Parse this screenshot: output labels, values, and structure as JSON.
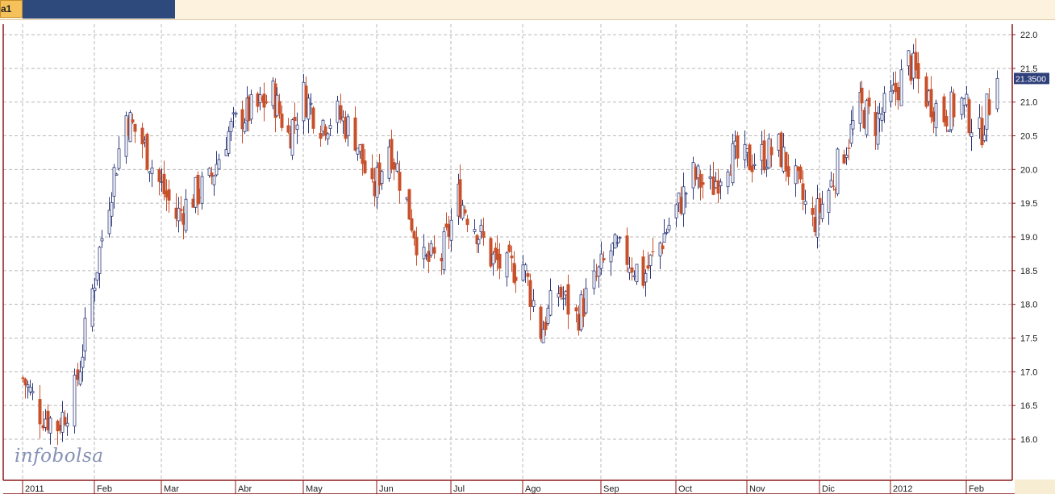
{
  "tab": {
    "label": "a1"
  },
  "watermark": {
    "text": "infobolsa"
  },
  "chart_data": {
    "type": "candlestick",
    "title": "",
    "xlabel": "",
    "ylabel": "",
    "ylim": [
      15.5,
      22.2
    ],
    "y_ticks": [
      "22.0",
      "21.5",
      "21.0",
      "20.5",
      "20.0",
      "19.5",
      "19.0",
      "18.5",
      "18.0",
      "17.5",
      "17.0",
      "16.5",
      "16.0"
    ],
    "x_ticks": [
      {
        "label": "2011",
        "date": "2011-01-03"
      },
      {
        "label": "Feb",
        "date": "2011-02-01"
      },
      {
        "label": "Mar",
        "date": "2011-03-01"
      },
      {
        "label": "Abr",
        "date": "2011-04-01"
      },
      {
        "label": "May",
        "date": "2011-05-02"
      },
      {
        "label": "Jun",
        "date": "2011-06-01"
      },
      {
        "label": "Jul",
        "date": "2011-07-01"
      },
      {
        "label": "Ago",
        "date": "2011-08-01"
      },
      {
        "label": "Sep",
        "date": "2011-09-01"
      },
      {
        "label": "Oct",
        "date": "2011-10-03"
      },
      {
        "label": "Nov",
        "date": "2011-11-01"
      },
      {
        "label": "Dic",
        "date": "2011-12-01"
      },
      {
        "label": "2012",
        "date": "2012-01-02"
      },
      {
        "label": "Feb",
        "date": "2012-02-01"
      }
    ],
    "last_price": "21.3500",
    "grid": true,
    "colors": {
      "up": "#2e3a7a",
      "down": "#c8502a",
      "grid": "#b8b8b8",
      "axis": "#8b1a1a",
      "tag": "#2e3f7a"
    },
    "closes": [
      {
        "date": "2011-01-03",
        "close": 16.9
      },
      {
        "date": "2011-01-10",
        "close": 16.4
      },
      {
        "date": "2011-01-17",
        "close": 16.2
      },
      {
        "date": "2011-01-24",
        "close": 16.7
      },
      {
        "date": "2011-01-31",
        "close": 18.2
      },
      {
        "date": "2011-02-07",
        "close": 19.6
      },
      {
        "date": "2011-02-14",
        "close": 20.8
      },
      {
        "date": "2011-02-21",
        "close": 20.4
      },
      {
        "date": "2011-02-28",
        "close": 19.8
      },
      {
        "date": "2011-03-07",
        "close": 19.3
      },
      {
        "date": "2011-03-14",
        "close": 19.6
      },
      {
        "date": "2011-03-21",
        "close": 19.8
      },
      {
        "date": "2011-03-28",
        "close": 20.5
      },
      {
        "date": "2011-04-04",
        "close": 20.8
      },
      {
        "date": "2011-04-11",
        "close": 20.9
      },
      {
        "date": "2011-04-18",
        "close": 21.1
      },
      {
        "date": "2011-04-25",
        "close": 20.5
      },
      {
        "date": "2011-05-02",
        "close": 21.1
      },
      {
        "date": "2011-05-09",
        "close": 20.7
      },
      {
        "date": "2011-05-16",
        "close": 20.8
      },
      {
        "date": "2011-05-23",
        "close": 20.5
      },
      {
        "date": "2011-05-30",
        "close": 19.6
      },
      {
        "date": "2011-06-06",
        "close": 20.4
      },
      {
        "date": "2011-06-13",
        "close": 19.5
      },
      {
        "date": "2011-06-20",
        "close": 18.6
      },
      {
        "date": "2011-06-27",
        "close": 18.7
      },
      {
        "date": "2011-07-04",
        "close": 19.6
      },
      {
        "date": "2011-07-11",
        "close": 19.2
      },
      {
        "date": "2011-07-18",
        "close": 18.7
      },
      {
        "date": "2011-07-25",
        "close": 18.5
      },
      {
        "date": "2011-08-01",
        "close": 18.6
      },
      {
        "date": "2011-08-08",
        "close": 17.6
      },
      {
        "date": "2011-08-15",
        "close": 18.2
      },
      {
        "date": "2011-08-22",
        "close": 17.8
      },
      {
        "date": "2011-08-29",
        "close": 18.3
      },
      {
        "date": "2011-09-05",
        "close": 18.8
      },
      {
        "date": "2011-09-12",
        "close": 18.7
      },
      {
        "date": "2011-09-19",
        "close": 18.4
      },
      {
        "date": "2011-09-26",
        "close": 18.9
      },
      {
        "date": "2011-10-03",
        "close": 19.4
      },
      {
        "date": "2011-10-10",
        "close": 19.9
      },
      {
        "date": "2011-10-17",
        "close": 19.7
      },
      {
        "date": "2011-10-24",
        "close": 20.2
      },
      {
        "date": "2011-10-31",
        "close": 20.1
      },
      {
        "date": "2011-11-07",
        "close": 20.2
      },
      {
        "date": "2011-11-14",
        "close": 20.3
      },
      {
        "date": "2011-11-21",
        "close": 19.8
      },
      {
        "date": "2011-11-28",
        "close": 19.2
      },
      {
        "date": "2011-12-05",
        "close": 19.7
      },
      {
        "date": "2011-12-12",
        "close": 20.3
      },
      {
        "date": "2011-12-19",
        "close": 20.9
      },
      {
        "date": "2011-12-26",
        "close": 20.7
      },
      {
        "date": "2012-01-02",
        "close": 21.0
      },
      {
        "date": "2012-01-09",
        "close": 21.6
      },
      {
        "date": "2012-01-16",
        "close": 21.1
      },
      {
        "date": "2012-01-23",
        "close": 20.8
      },
      {
        "date": "2012-01-30",
        "close": 21.0
      },
      {
        "date": "2012-02-06",
        "close": 20.5
      },
      {
        "date": "2012-02-13",
        "close": 21.35
      }
    ]
  }
}
